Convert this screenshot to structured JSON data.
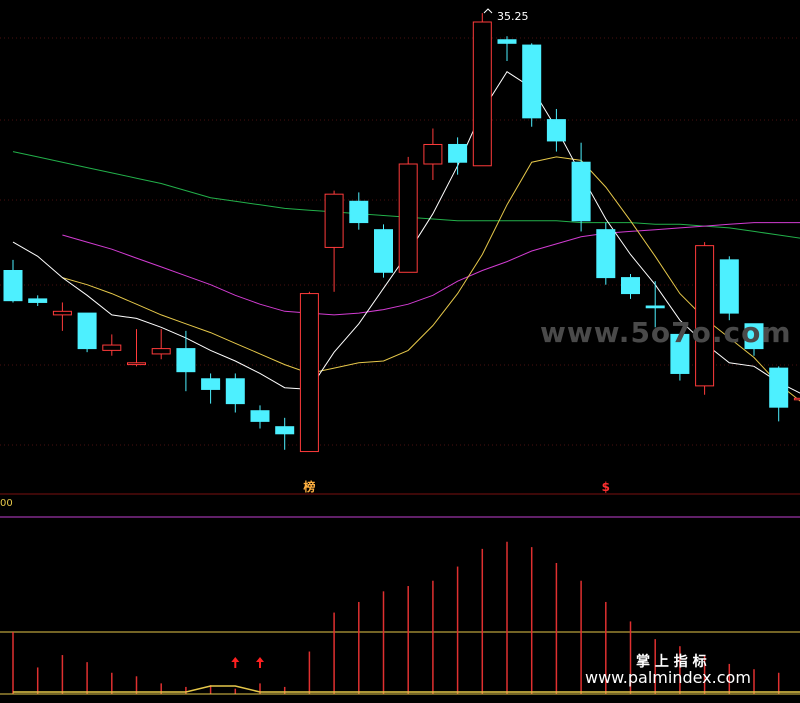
{
  "chart_data": [
    {
      "type": "candlestick",
      "annotations": {
        "high_label": "35.25"
      },
      "colors": {
        "up": "#ff3b3b",
        "down": "#4df0ff",
        "ma5": "#ffffff",
        "ma10": "#e6c84a",
        "ma20": "#d23cd2",
        "ma60": "#22b04a",
        "background": "#000000"
      },
      "ohlc": [
        {
          "o": 28.0,
          "h": 28.3,
          "l": 27.1,
          "c": 27.15
        },
        {
          "o": 27.2,
          "h": 27.3,
          "l": 27.0,
          "c": 27.1
        },
        {
          "o": 26.75,
          "h": 27.1,
          "l": 26.3,
          "c": 26.85
        },
        {
          "o": 26.8,
          "h": 26.8,
          "l": 25.7,
          "c": 25.8
        },
        {
          "o": 25.75,
          "h": 26.2,
          "l": 25.6,
          "c": 25.9
        },
        {
          "o": 25.35,
          "h": 26.35,
          "l": 25.3,
          "c": 25.4
        },
        {
          "o": 25.65,
          "h": 26.35,
          "l": 25.5,
          "c": 25.8
        },
        {
          "o": 25.8,
          "h": 26.3,
          "l": 24.6,
          "c": 25.15
        },
        {
          "o": 24.95,
          "h": 25.1,
          "l": 24.25,
          "c": 24.65
        },
        {
          "o": 24.95,
          "h": 25.1,
          "l": 24.0,
          "c": 24.25
        },
        {
          "o": 24.05,
          "h": 24.2,
          "l": 23.55,
          "c": 23.75
        },
        {
          "o": 23.6,
          "h": 23.85,
          "l": 22.95,
          "c": 23.4
        },
        {
          "o": 22.9,
          "h": 27.4,
          "l": 22.9,
          "c": 27.35
        },
        {
          "o": 28.65,
          "h": 30.25,
          "l": 27.4,
          "c": 30.15
        },
        {
          "o": 29.95,
          "h": 30.2,
          "l": 29.15,
          "c": 29.35
        },
        {
          "o": 29.15,
          "h": 29.3,
          "l": 27.8,
          "c": 27.95
        },
        {
          "o": 27.95,
          "h": 31.2,
          "l": 27.95,
          "c": 31.0
        },
        {
          "o": 31.0,
          "h": 32.0,
          "l": 30.55,
          "c": 31.55
        },
        {
          "o": 31.55,
          "h": 31.75,
          "l": 30.7,
          "c": 31.05
        },
        {
          "o": 30.95,
          "h": 35.25,
          "l": 30.95,
          "c": 35.0
        },
        {
          "o": 34.5,
          "h": 34.6,
          "l": 33.9,
          "c": 34.4
        },
        {
          "o": 34.35,
          "h": 34.4,
          "l": 32.05,
          "c": 32.3
        },
        {
          "o": 32.25,
          "h": 32.55,
          "l": 31.35,
          "c": 31.65
        },
        {
          "o": 31.05,
          "h": 31.6,
          "l": 29.1,
          "c": 29.4
        },
        {
          "o": 29.15,
          "h": 29.35,
          "l": 27.6,
          "c": 27.8
        },
        {
          "o": 27.8,
          "h": 27.9,
          "l": 27.2,
          "c": 27.35
        },
        {
          "o": 27.0,
          "h": 27.7,
          "l": 26.4,
          "c": 26.95
        },
        {
          "o": 26.2,
          "h": 26.2,
          "l": 24.9,
          "c": 25.1
        },
        {
          "o": 24.75,
          "h": 28.8,
          "l": 24.5,
          "c": 28.7
        },
        {
          "o": 28.3,
          "h": 28.4,
          "l": 26.6,
          "c": 26.8
        },
        {
          "o": 26.5,
          "h": 26.5,
          "l": 25.6,
          "c": 25.8
        },
        {
          "o": 25.25,
          "h": 25.3,
          "l": 23.75,
          "c": 24.15
        },
        {
          "o": 24.4,
          "h": 24.55,
          "l": 24.3,
          "c": 24.4
        }
      ],
      "ma5": [
        28.8,
        28.4,
        27.8,
        27.3,
        26.75,
        26.65,
        26.4,
        26.1,
        25.75,
        25.45,
        25.1,
        24.7,
        24.65,
        25.7,
        26.5,
        27.5,
        28.5,
        29.6,
        30.95,
        32.5,
        33.6,
        33.15,
        32.0,
        30.7,
        29.45,
        28.45,
        27.6,
        26.6,
        25.95,
        25.4,
        25.3,
        24.85,
        24.5
      ],
      "ma10": [
        null,
        null,
        27.8,
        27.6,
        27.35,
        27.05,
        26.75,
        26.5,
        26.25,
        25.95,
        25.65,
        25.35,
        25.1,
        25.25,
        25.4,
        25.45,
        25.75,
        26.45,
        27.35,
        28.45,
        29.85,
        31.05,
        31.2,
        31.1,
        30.35,
        29.4,
        28.4,
        27.35,
        26.65,
        26.1,
        25.55,
        24.8,
        24.25
      ],
      "ma20": [
        null,
        null,
        29.0,
        28.8,
        28.6,
        28.35,
        28.1,
        27.85,
        27.6,
        27.3,
        27.05,
        26.85,
        26.8,
        26.75,
        26.8,
        26.9,
        27.05,
        27.3,
        27.7,
        28.0,
        28.25,
        28.55,
        28.75,
        28.95,
        29.05,
        29.1,
        29.15,
        29.2,
        29.25,
        29.3,
        29.35,
        29.35,
        29.35
      ],
      "ma60": [
        31.35,
        31.2,
        31.05,
        30.9,
        30.75,
        30.6,
        30.45,
        30.25,
        30.05,
        29.95,
        29.85,
        29.75,
        29.7,
        29.65,
        29.6,
        29.55,
        29.5,
        29.45,
        29.4,
        29.4,
        29.4,
        29.4,
        29.4,
        29.35,
        29.35,
        29.35,
        29.3,
        29.3,
        29.25,
        29.2,
        29.1,
        29.0,
        28.9
      ],
      "event_markers": [
        {
          "index": 12,
          "label": "榜"
        },
        {
          "index": 24,
          "label": "$"
        }
      ]
    },
    {
      "type": "bar",
      "axis_label": "00",
      "reference_levels": [
        100,
        35
      ],
      "values": [
        35,
        15,
        22,
        18,
        12,
        10,
        6,
        4,
        5,
        3,
        6,
        4,
        24,
        46,
        52,
        58,
        61,
        64,
        72,
        82,
        86,
        83,
        74,
        64,
        52,
        41,
        31,
        27,
        22,
        17,
        14,
        12,
        9
      ],
      "signal_line": [
        0,
        0,
        0,
        0,
        0,
        0,
        0,
        0,
        3,
        3,
        0,
        0,
        0,
        0,
        0,
        0,
        0,
        0,
        0,
        0,
        0,
        0,
        0,
        0,
        0,
        0,
        0,
        0,
        0,
        0,
        0,
        0,
        0
      ],
      "arrow_indices": [
        9,
        10
      ],
      "colors": {
        "bars": "#e03030",
        "signal": "#e6c84a",
        "level_high": "#c040d0",
        "level_low": "#e6c84a",
        "arrow": "#ff2020"
      }
    }
  ],
  "watermarks": {
    "center": "www.5o7o.com",
    "bottom_cn": "掌 上 指 标",
    "bottom_url": "www.palmindex.com"
  }
}
